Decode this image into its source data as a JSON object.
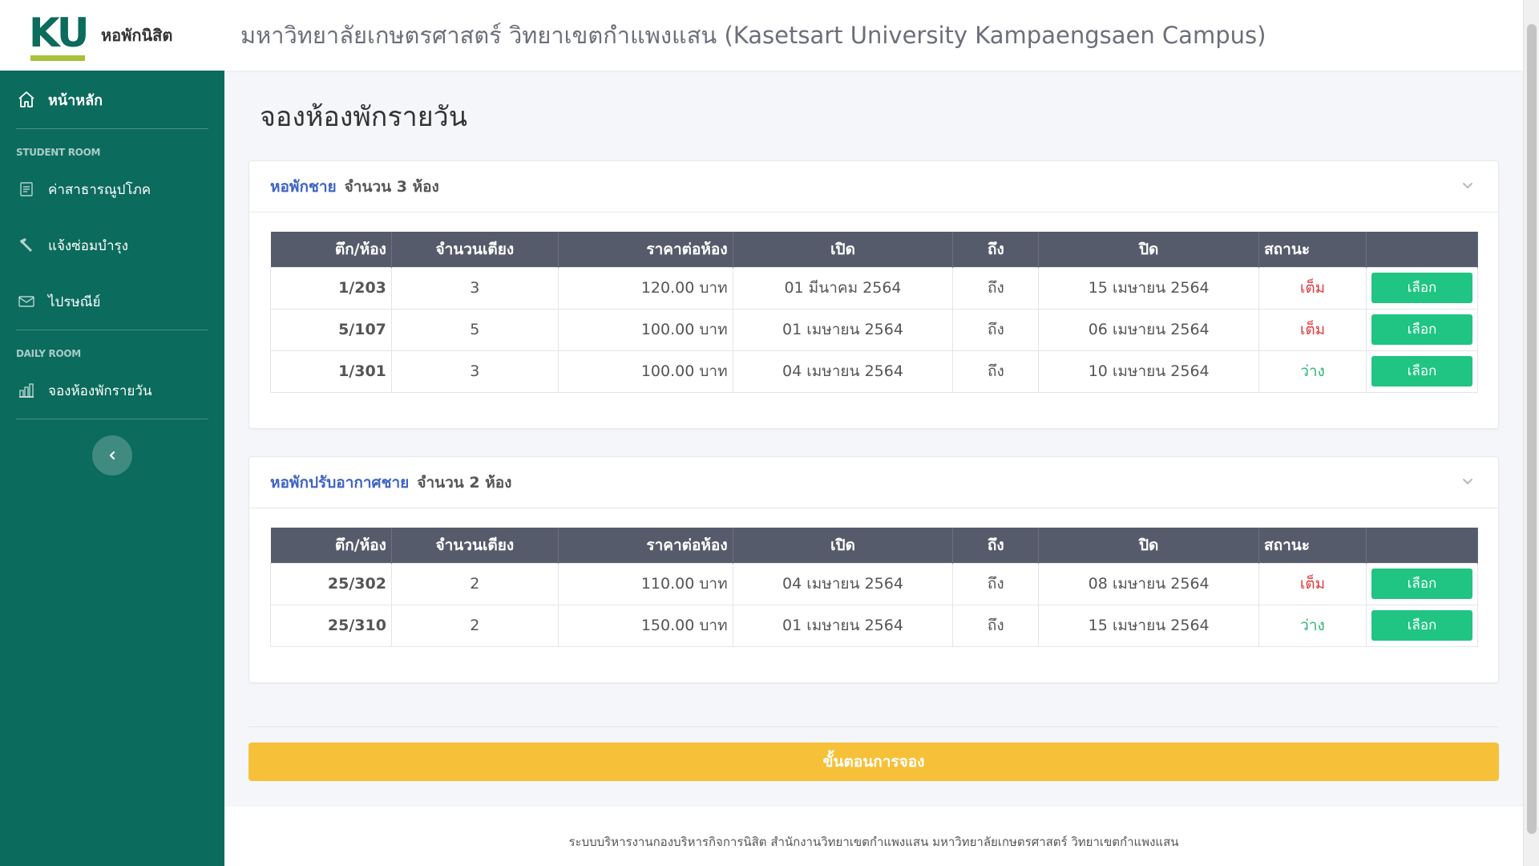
{
  "header": {
    "logo_text": "KU",
    "brand_name": "หอพักนิสิต",
    "site_title": "มหาวิทยาลัยเกษตรศาสตร์ วิทยาเขตกำแพงแสน (Kasetsart University Kampaengsaen Campus)"
  },
  "sidebar": {
    "home": "หน้าหลัก",
    "section_student": "STUDENT ROOM",
    "items_student": [
      "ค่าสาธารณูปโภค",
      "แจ้งซ่อมบำรุง",
      "ไปรษณีย์"
    ],
    "section_daily": "DAILY ROOM",
    "items_daily": [
      "จองห้องพักรายวัน"
    ]
  },
  "page": {
    "title": "จองห้องพักรายวัน"
  },
  "table_headers": [
    "ตึก/ห้อง",
    "จำนวนเตียง",
    "ราคาต่อห้อง",
    "เปิด",
    "ถึง",
    "ปิด",
    "สถานะ",
    ""
  ],
  "groups": [
    {
      "name": "หอพักชาย",
      "count": "จำนวน 3 ห้อง",
      "rows": [
        {
          "room": "1/203",
          "beds": "3",
          "price": "120.00 บาท",
          "open": "01 มีนาคม 2564",
          "to": "ถึง",
          "close": "15 เมษายน 2564",
          "status": "เต็ม",
          "status_type": "full",
          "action": "เลือก"
        },
        {
          "room": "5/107",
          "beds": "5",
          "price": "100.00 บาท",
          "open": "01 เมษายน 2564",
          "to": "ถึง",
          "close": "06 เมษายน 2564",
          "status": "เต็ม",
          "status_type": "full",
          "action": "เลือก"
        },
        {
          "room": "1/301",
          "beds": "3",
          "price": "100.00 บาท",
          "open": "04 เมษายน 2564",
          "to": "ถึง",
          "close": "10 เมษายน 2564",
          "status": "ว่าง",
          "status_type": "free",
          "action": "เลือก"
        }
      ]
    },
    {
      "name": "หอพักปรับอากาศชาย",
      "count": "จำนวน 2 ห้อง",
      "rows": [
        {
          "room": "25/302",
          "beds": "2",
          "price": "110.00 บาท",
          "open": "04 เมษายน 2564",
          "to": "ถึง",
          "close": "08 เมษายน 2564",
          "status": "เต็ม",
          "status_type": "full",
          "action": "เลือก"
        },
        {
          "room": "25/310",
          "beds": "2",
          "price": "150.00 บาท",
          "open": "01 เมษายน 2564",
          "to": "ถึง",
          "close": "15 เมษายน 2564",
          "status": "ว่าง",
          "status_type": "free",
          "action": "เลือก"
        }
      ]
    }
  ],
  "booking_button": "ขั้นตอนการจอง",
  "footer": "ระบบบริหารงานกองบริหารกิจการนิสิต สำนักงานวิทยาเขตกำแพงแสน มหาวิทยาลัยเกษตรศาสตร์ วิทยาเขตกำแพงแสน",
  "colors": {
    "sidebar": "#0b6b5c",
    "accent_green": "#20c483",
    "status_full": "#e03b3b",
    "status_free": "#2bb673",
    "book_button": "#f6c139",
    "table_header": "#565b6b",
    "group_title": "#3e63c4"
  },
  "icons": {
    "home": "home-icon",
    "utilities": "document-icon",
    "repair": "hammer-icon",
    "mail": "envelope-icon",
    "daily": "building-chart-icon",
    "collapse": "chevron-left-icon",
    "card_toggle": "chevron-down-icon"
  }
}
